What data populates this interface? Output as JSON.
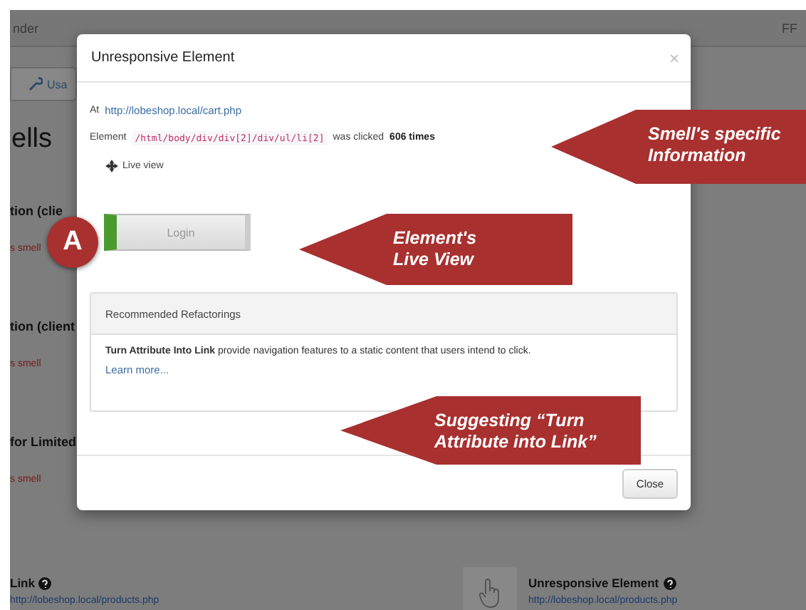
{
  "background": {
    "app_title": "nder",
    "top_right": "FF",
    "tab": "Usa",
    "heading": "ells",
    "items": [
      {
        "title": "tion (clie",
        "detail": "s smell"
      },
      {
        "title": "tion (client",
        "detail": "s smell"
      },
      {
        "title": "for Limited",
        "detail": "s smell"
      }
    ],
    "cards": [
      {
        "title": "Link",
        "link": "http://lobeshop.local/products.php",
        "kind": "plain"
      },
      {
        "title": "Unresponsive Element",
        "link": "http://lobeshop.local/products.php",
        "kind": "hand"
      }
    ]
  },
  "modal": {
    "title": "Unresponsive Element",
    "close_icon": "×",
    "at_label": "At",
    "url": "http://lobeshop.local/cart.php",
    "element_label": "Element",
    "xpath": "/html/body/div/div[2]/div/ul/li[2]",
    "clicked": "was clicked",
    "count": "606 times",
    "live_view": "Live view",
    "preview_button": "Login",
    "marker": "A",
    "refactorings": {
      "header": "Recommended Refactorings",
      "body": "**Turn Attribute Into Link** provide navigation features to a static content that users intend to click.",
      "link": "Learn more..."
    },
    "close_button": "Close"
  },
  "callouts": [
    {
      "lines": [
        "Smell's specific",
        "Information"
      ]
    },
    {
      "lines": [
        "Element's",
        "Live View"
      ]
    },
    {
      "lines": [
        "Suggesting “Turn",
        "Attribute into Link”"
      ]
    }
  ]
}
